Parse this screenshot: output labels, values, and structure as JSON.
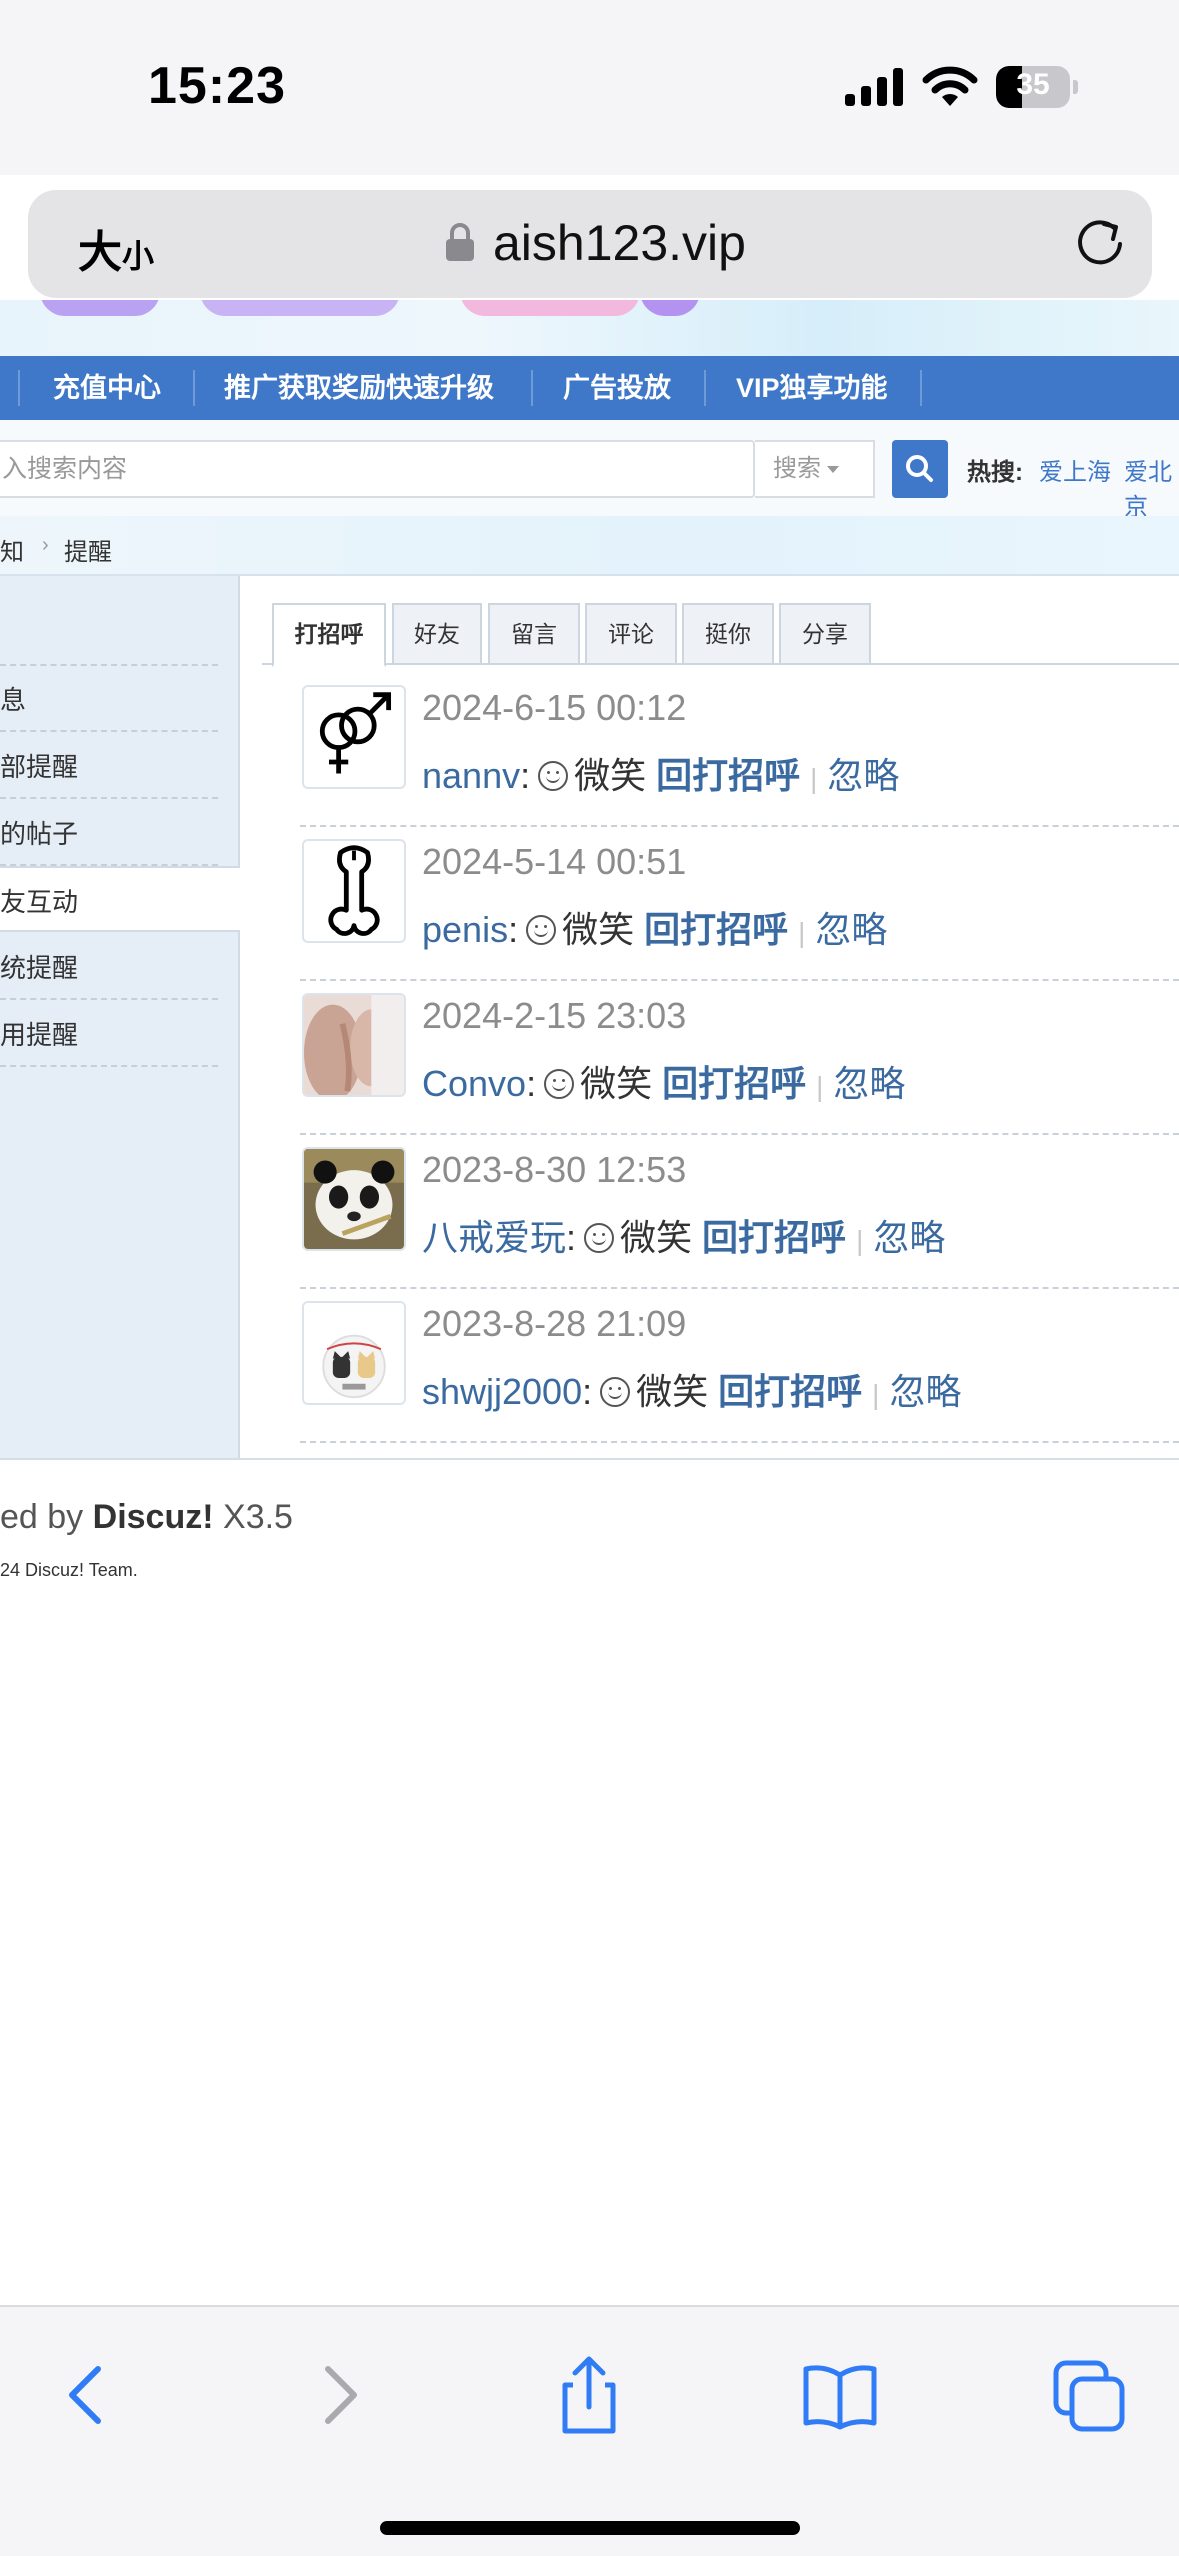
{
  "status_bar": {
    "time": "15:23",
    "battery": "35",
    "battery_level": 0.35
  },
  "address_bar": {
    "text_size_big": "大",
    "text_size_small": "小",
    "url": "aish123.vip"
  },
  "nav": {
    "items": [
      "充值中心",
      "推广获取奖励快速升级",
      "广告投放",
      "VIP独享功能"
    ]
  },
  "search": {
    "placeholder": "入搜索内容",
    "type_label": "搜索",
    "hot_label": "热搜:",
    "hot_links": [
      "爱上海",
      "爱北京"
    ]
  },
  "breadcrumb": {
    "items": [
      "知",
      "提醒"
    ]
  },
  "sidebar": {
    "items": [
      "息",
      "部提醒",
      "的帖子",
      "友互动",
      "统提醒",
      "用提醒"
    ],
    "active_index": 3
  },
  "tabs": {
    "items": [
      "打招呼",
      "好友",
      "留言",
      "评论",
      "挺你",
      "分享"
    ],
    "active_index": 0
  },
  "entries": [
    {
      "time": "2024-6-15 00:12",
      "user": "nannv",
      "action": "微笑",
      "reply": "回打招呼",
      "ignore": "忽略",
      "avatar": "gender-symbols-icon"
    },
    {
      "time": "2024-5-14 00:51",
      "user": "penis",
      "action": "微笑",
      "reply": "回打招呼",
      "ignore": "忽略",
      "avatar": "penis-outline-icon"
    },
    {
      "time": "2024-2-15 23:03",
      "user": "Convo",
      "action": "微笑",
      "reply": "回打招呼",
      "ignore": "忽略",
      "avatar": "photo-avatar"
    },
    {
      "time": "2023-8-30 12:53",
      "user": "八戒爱玩",
      "action": "微笑",
      "reply": "回打招呼",
      "ignore": "忽略",
      "avatar": "panda-photo-avatar"
    },
    {
      "time": "2023-8-28 21:09",
      "user": "shwjj2000",
      "action": "微笑",
      "reply": "回打招呼",
      "ignore": "忽略",
      "avatar": "cartoon-cats-avatar"
    }
  ],
  "footer": {
    "powered_prefix": "ed by",
    "powered_brand": "Discuz!",
    "powered_version": "X3.5",
    "copyright": "24 Discuz! Team."
  },
  "colors": {
    "nav_blue": "#3f78c8",
    "link_blue": "#3b6aa0",
    "sidebar_bg": "#e5edf7"
  }
}
